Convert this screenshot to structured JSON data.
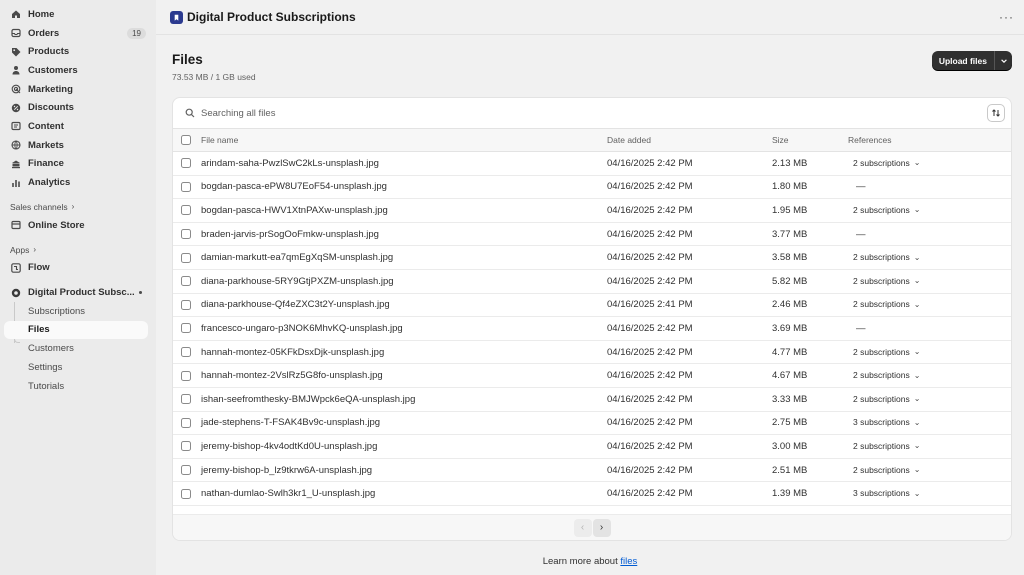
{
  "sidebar": {
    "nav": [
      {
        "label": "Home",
        "icon": "home-icon"
      },
      {
        "label": "Orders",
        "icon": "orders-icon",
        "count": "19"
      },
      {
        "label": "Products",
        "icon": "tag-icon"
      },
      {
        "label": "Customers",
        "icon": "person-icon"
      },
      {
        "label": "Marketing",
        "icon": "target-icon"
      },
      {
        "label": "Discounts",
        "icon": "discount-icon"
      },
      {
        "label": "Content",
        "icon": "content-icon"
      },
      {
        "label": "Markets",
        "icon": "globe-icon"
      },
      {
        "label": "Finance",
        "icon": "bank-icon"
      },
      {
        "label": "Analytics",
        "icon": "chart-icon"
      }
    ],
    "sales_channels_label": "Sales channels",
    "online_store_label": "Online Store",
    "apps_label": "Apps",
    "flow_label": "Flow",
    "app_name": "Digital Product Subsc...",
    "app_subitems": [
      "Subscriptions",
      "Files",
      "Customers",
      "Settings",
      "Tutorials"
    ],
    "active_subitem": "Files"
  },
  "topbar": {
    "title": "Digital Product Subscriptions",
    "more": "···"
  },
  "header": {
    "title": "Files",
    "usage": "73.53 MB / 1 GB used",
    "upload_label": "Upload files"
  },
  "search": {
    "placeholder": "Searching all files"
  },
  "table": {
    "columns": [
      "File name",
      "Date added",
      "Size",
      "References"
    ],
    "rows": [
      {
        "name": "arindam-saha-PwzlSwC2kLs-unsplash.jpg",
        "date": "04/16/2025 2:42 PM",
        "size": "2.13 MB",
        "refs": "2 subscriptions"
      },
      {
        "name": "bogdan-pasca-ePW8U7EoF54-unsplash.jpg",
        "date": "04/16/2025 2:42 PM",
        "size": "1.80 MB",
        "refs": "—"
      },
      {
        "name": "bogdan-pasca-HWV1XtnPAXw-unsplash.jpg",
        "date": "04/16/2025 2:42 PM",
        "size": "1.95 MB",
        "refs": "2 subscriptions"
      },
      {
        "name": "braden-jarvis-prSogOoFmkw-unsplash.jpg",
        "date": "04/16/2025 2:42 PM",
        "size": "3.77 MB",
        "refs": "—"
      },
      {
        "name": "damian-markutt-ea7qmEgXqSM-unsplash.jpg",
        "date": "04/16/2025 2:42 PM",
        "size": "3.58 MB",
        "refs": "2 subscriptions"
      },
      {
        "name": "diana-parkhouse-5RY9GtjPXZM-unsplash.jpg",
        "date": "04/16/2025 2:42 PM",
        "size": "5.82 MB",
        "refs": "2 subscriptions"
      },
      {
        "name": "diana-parkhouse-Qf4eZXC3t2Y-unsplash.jpg",
        "date": "04/16/2025 2:41 PM",
        "size": "2.46 MB",
        "refs": "2 subscriptions"
      },
      {
        "name": "francesco-ungaro-p3NOK6MhvKQ-unsplash.jpg",
        "date": "04/16/2025 2:42 PM",
        "size": "3.69 MB",
        "refs": "—"
      },
      {
        "name": "hannah-montez-05KFkDsxDjk-unsplash.jpg",
        "date": "04/16/2025 2:42 PM",
        "size": "4.77 MB",
        "refs": "2 subscriptions"
      },
      {
        "name": "hannah-montez-2VslRz5G8fo-unsplash.jpg",
        "date": "04/16/2025 2:42 PM",
        "size": "4.67 MB",
        "refs": "2 subscriptions"
      },
      {
        "name": "ishan-seefromthesky-BMJWpck6eQA-unsplash.jpg",
        "date": "04/16/2025 2:42 PM",
        "size": "3.33 MB",
        "refs": "2 subscriptions"
      },
      {
        "name": "jade-stephens-T-FSAK4Bv9c-unsplash.jpg",
        "date": "04/16/2025 2:42 PM",
        "size": "2.75 MB",
        "refs": "3 subscriptions"
      },
      {
        "name": "jeremy-bishop-4kv4odtKd0U-unsplash.jpg",
        "date": "04/16/2025 2:42 PM",
        "size": "3.00 MB",
        "refs": "2 subscriptions"
      },
      {
        "name": "jeremy-bishop-b_lz9tkrw6A-unsplash.jpg",
        "date": "04/16/2025 2:42 PM",
        "size": "2.51 MB",
        "refs": "2 subscriptions"
      },
      {
        "name": "nathan-dumlao-Swlh3kr1_U-unsplash.jpg",
        "date": "04/16/2025 2:42 PM",
        "size": "1.39 MB",
        "refs": "3 subscriptions"
      }
    ]
  },
  "footer": {
    "learn_prefix": "Learn more about",
    "learn_link": "files"
  },
  "colors": {
    "link": "#005bd3",
    "primary_button": "#303030",
    "app_icon": "#2b3a8f"
  }
}
